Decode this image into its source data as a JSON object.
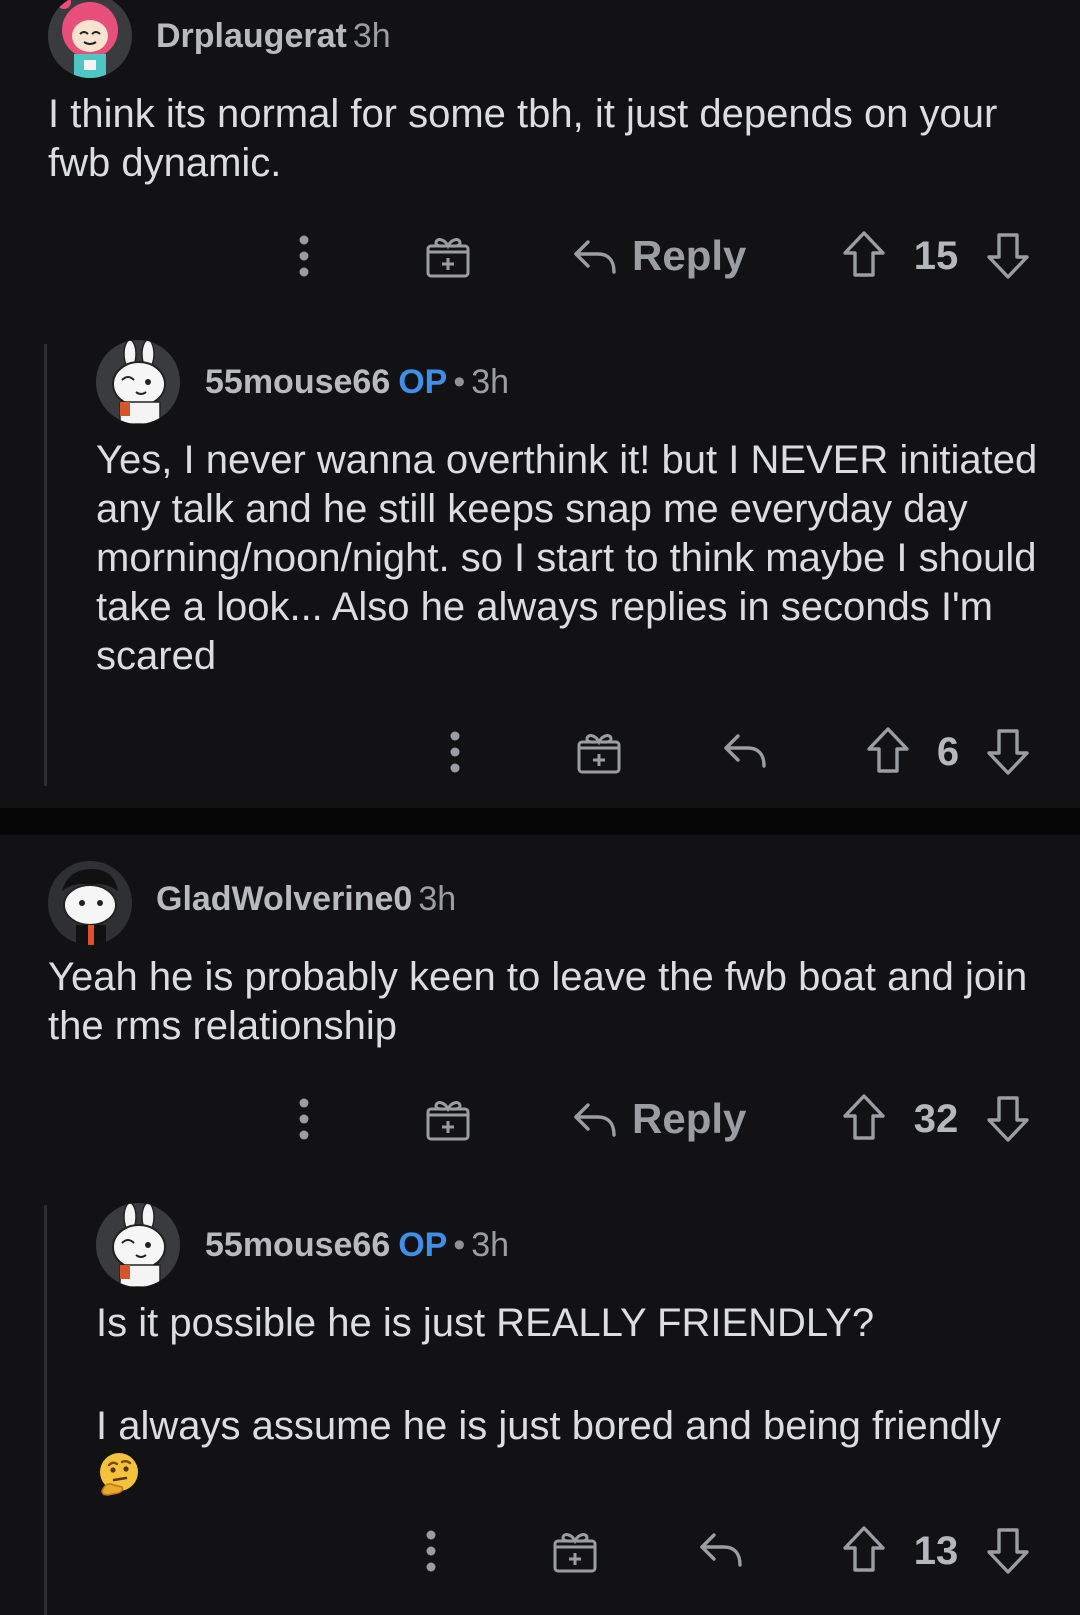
{
  "comments": [
    {
      "username": "Drplaugerat",
      "time": "3h",
      "body": [
        "I think its normal for some tbh, it just depends on your fwb dynamic."
      ],
      "reply_label": "Reply",
      "votes": "15",
      "avatar_icon": "pink-hair-avatar-icon"
    },
    {
      "username": "55mouse66",
      "op_badge": "OP",
      "separator": "•",
      "time": "3h",
      "body": [
        "Yes, I never wanna overthink it! but I NEVER initiated any talk and he still keeps snap me everyday day morning/noon/night. so I start to think maybe I should take a look... Also he always replies in seconds I'm scared"
      ],
      "votes": "6",
      "avatar_icon": "bunny-avatar-icon"
    },
    {
      "username": "GladWolverine0",
      "time": "3h",
      "body": [
        "Yeah he is probably keen to leave the fwb boat and join the rms relationship"
      ],
      "reply_label": "Reply",
      "votes": "32",
      "avatar_icon": "dark-hair-avatar-icon"
    },
    {
      "username": "55mouse66",
      "op_badge": "OP",
      "separator": "•",
      "time": "3h",
      "body": [
        "Is it possible he is just REALLY FRIENDLY?",
        "I always assume he is just bored and being friendly"
      ],
      "emoji": "thinking-face-emoji",
      "votes": "13",
      "avatar_icon": "bunny-avatar-icon"
    }
  ],
  "colors": {
    "background": "#121214",
    "separator": "#060607",
    "op_badge": "#3d8fe8",
    "text": "#dcdddf",
    "muted": "#9a9da2"
  },
  "icons": [
    "more-options-icon",
    "award-gift-icon",
    "reply-arrow-icon",
    "upvote-icon",
    "downvote-icon"
  ]
}
